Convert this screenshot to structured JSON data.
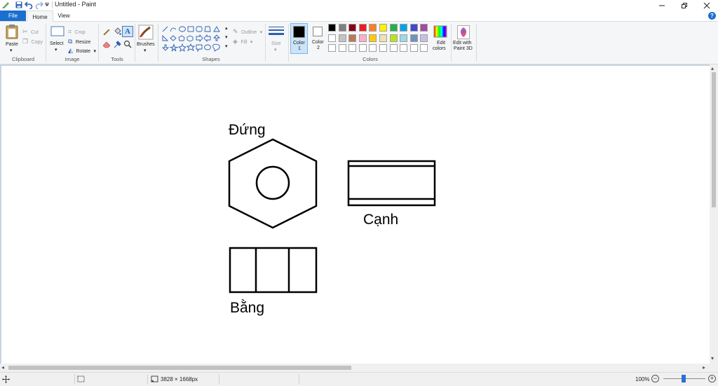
{
  "window": {
    "title": "Untitled - Paint",
    "minimize_icon": "minimize-icon",
    "maximize_icon": "restore-icon",
    "close_icon": "close-icon"
  },
  "quick_access": [
    "paint-app-icon",
    "save-icon",
    "undo-icon",
    "redo-icon",
    "customize-dropdown-icon"
  ],
  "tabs": {
    "file": "File",
    "home": "Home",
    "view": "View"
  },
  "ribbon": {
    "clipboard": {
      "group_label": "Clipboard",
      "paste": "Paste",
      "cut": "Cut",
      "copy": "Copy"
    },
    "image": {
      "group_label": "Image",
      "select": "Select",
      "crop": "Crop",
      "resize": "Resize",
      "rotate": "Rotate"
    },
    "tools": {
      "group_label": "Tools"
    },
    "brushes": {
      "label": "Brushes"
    },
    "shapes": {
      "group_label": "Shapes",
      "outline": "Outline",
      "fill": "Fill"
    },
    "size": {
      "label": "Size"
    },
    "colors": {
      "group_label": "Colors",
      "color1": "Color\n1",
      "color1_line1": "Color",
      "color1_line2": "1",
      "color2_line1": "Color",
      "color2_line2": "2",
      "color1_value": "#000000",
      "color2_value": "#ffffff",
      "edit_colors_line1": "Edit",
      "edit_colors_line2": "colors",
      "palette_row1": [
        "#000000",
        "#7f7f7f",
        "#880015",
        "#ed1c24",
        "#ff7f27",
        "#fff200",
        "#22b14c",
        "#00a2e8",
        "#3f48cc",
        "#a349a4"
      ],
      "palette_row2": [
        "#ffffff",
        "#c3c3c3",
        "#b97a57",
        "#ffaec9",
        "#ffc90e",
        "#efe4b0",
        "#b5e61d",
        "#99d9ea",
        "#7092be",
        "#c8bfe7"
      ],
      "palette_row3": [
        "#ffffff",
        "#ffffff",
        "#ffffff",
        "#ffffff",
        "#ffffff",
        "#ffffff",
        "#ffffff",
        "#ffffff",
        "#ffffff",
        "#ffffff"
      ]
    },
    "paint3d": {
      "line1": "Edit with",
      "line2": "Paint 3D"
    }
  },
  "canvas": {
    "label_front": "Đứng",
    "label_side": "Cạnh",
    "label_top": "Bằng"
  },
  "status": {
    "image_size": "3828 × 1668px",
    "zoom": "100%"
  }
}
